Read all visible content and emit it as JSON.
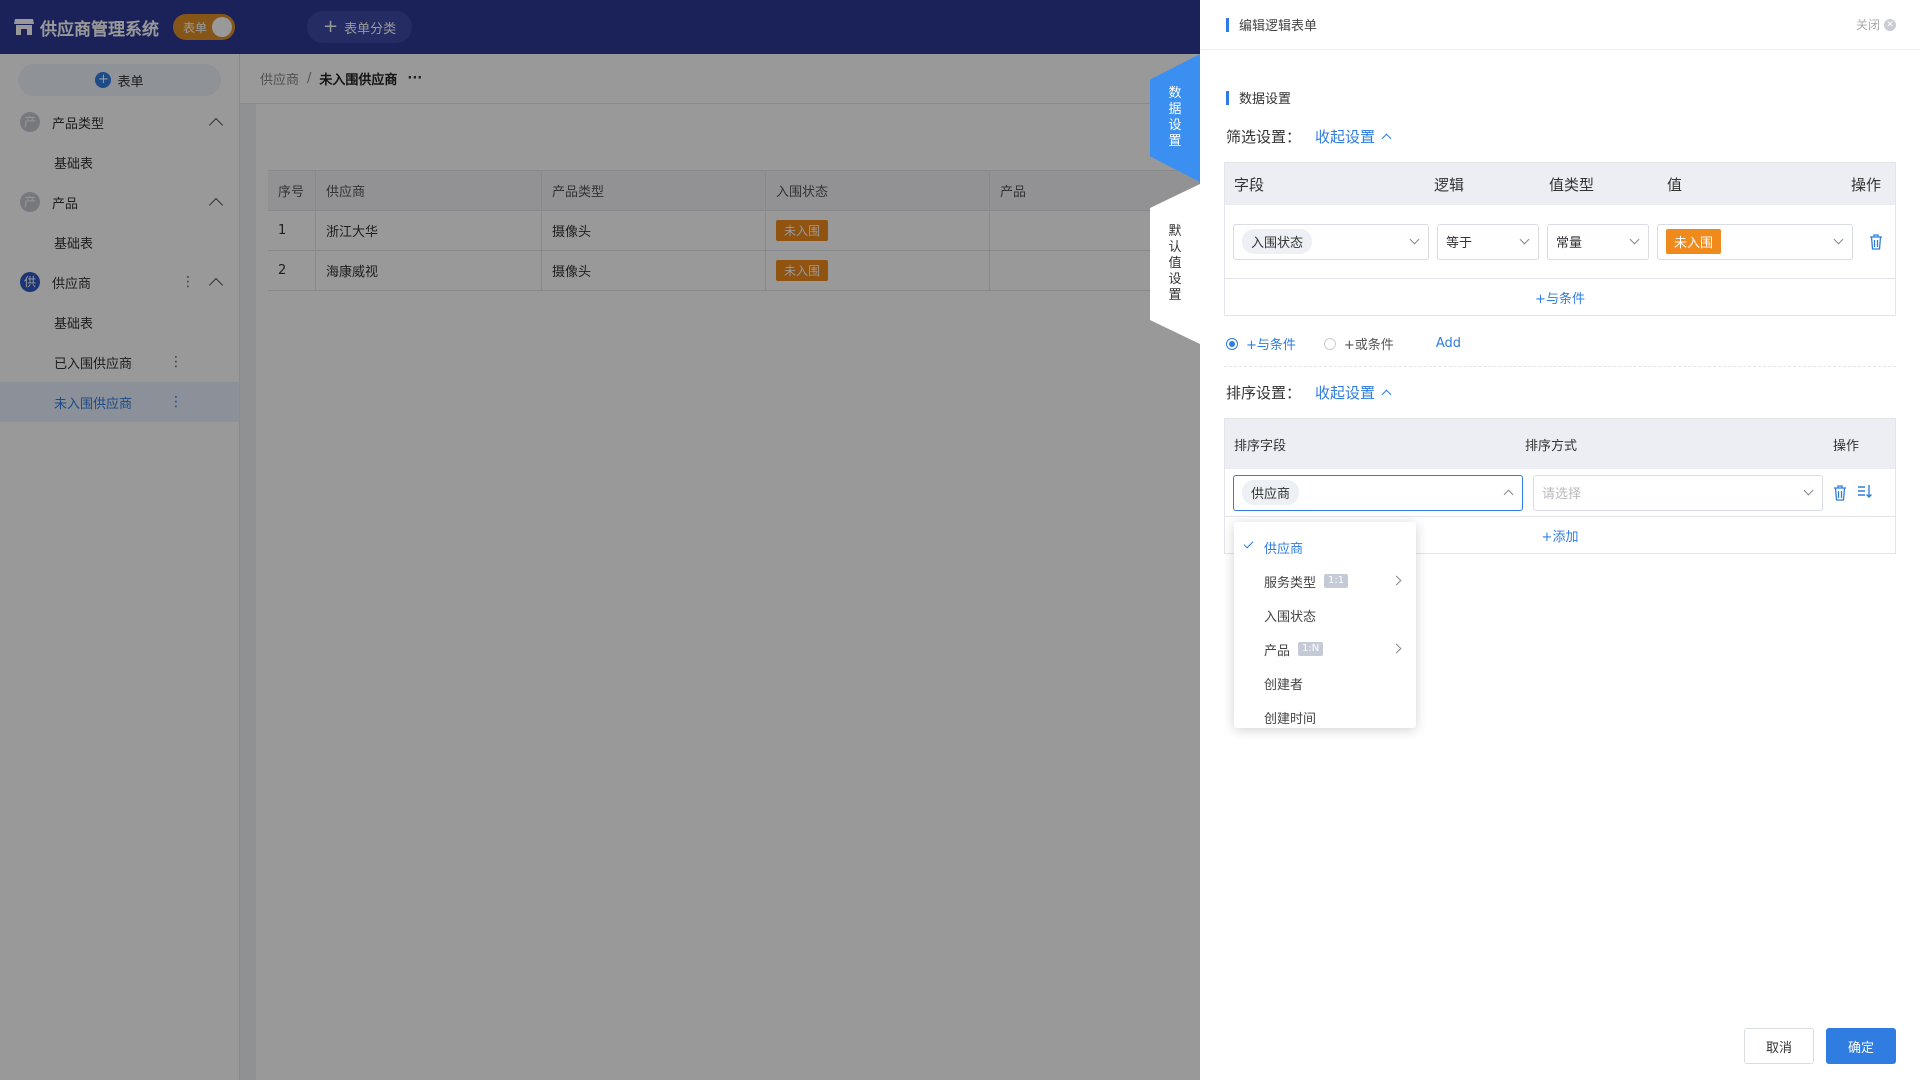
{
  "app": {
    "title": "供应商管理系统",
    "toggle_label": "表单",
    "category_button": "表单分类"
  },
  "sidebar": {
    "add_label": "表单",
    "groups": [
      {
        "icon_char": "产",
        "label": "产品类型",
        "children": [
          "基础表"
        ]
      },
      {
        "icon_char": "产",
        "label": "产品",
        "children": [
          "基础表"
        ]
      },
      {
        "icon_char": "供",
        "label": "供应商",
        "children": [
          "基础表",
          "已入围供应商",
          "未入围供应商"
        ]
      }
    ]
  },
  "breadcrumb": {
    "parent": "供应商",
    "separator": "/",
    "current": "未入围供应商",
    "more": "···"
  },
  "grid": {
    "headers": [
      "序号",
      "供应商",
      "产品类型",
      "入围状态",
      "产品"
    ],
    "rows": [
      [
        "1",
        "浙江大华",
        "摄像头",
        "未入围",
        ""
      ],
      [
        "2",
        "海康威视",
        "摄像头",
        "未入围",
        ""
      ]
    ]
  },
  "side_tabs": {
    "data": "数据设置",
    "default": "默认值设置"
  },
  "drawer": {
    "title": "编辑逻辑表单",
    "close": "关闭",
    "section": "数据设置",
    "filter_label": "筛选设置：",
    "collapse": "收起设置",
    "filter_headers": [
      "字段",
      "逻辑",
      "值类型",
      "值",
      "操作"
    ],
    "filter_row": {
      "field": "入围状态",
      "logic": "等于",
      "value_type": "常量",
      "value": "未入围"
    },
    "and_condition": "+与条件",
    "radio_and": "+与条件",
    "radio_or": "+或条件",
    "add": "Add",
    "sort_label": "排序设置：",
    "sort_headers": [
      "排序字段",
      "排序方式",
      "操作"
    ],
    "sort_row": {
      "field": "供应商",
      "method_placeholder": "请选择"
    },
    "sort_add": "+添加",
    "cancel": "取消",
    "confirm": "确定"
  },
  "dropdown": {
    "items": [
      {
        "label": "供应商",
        "selected": true
      },
      {
        "label": "服务类型",
        "rel": "1:1",
        "submenu": true
      },
      {
        "label": "入围状态"
      },
      {
        "label": "产品",
        "rel": "1:N",
        "submenu": true
      },
      {
        "label": "创建者"
      },
      {
        "label": "创建时间"
      }
    ]
  },
  "colors": {
    "primary": "#2f7de1",
    "topbar": "#2d3a96",
    "orange": "#f08a1c"
  },
  "icons": [
    "store-icon",
    "plus-icon",
    "chevron-up-icon",
    "more-vertical-icon",
    "trash-icon",
    "sort-icon",
    "close-icon",
    "check-icon",
    "chevron-down-icon",
    "chevron-right-icon"
  ]
}
